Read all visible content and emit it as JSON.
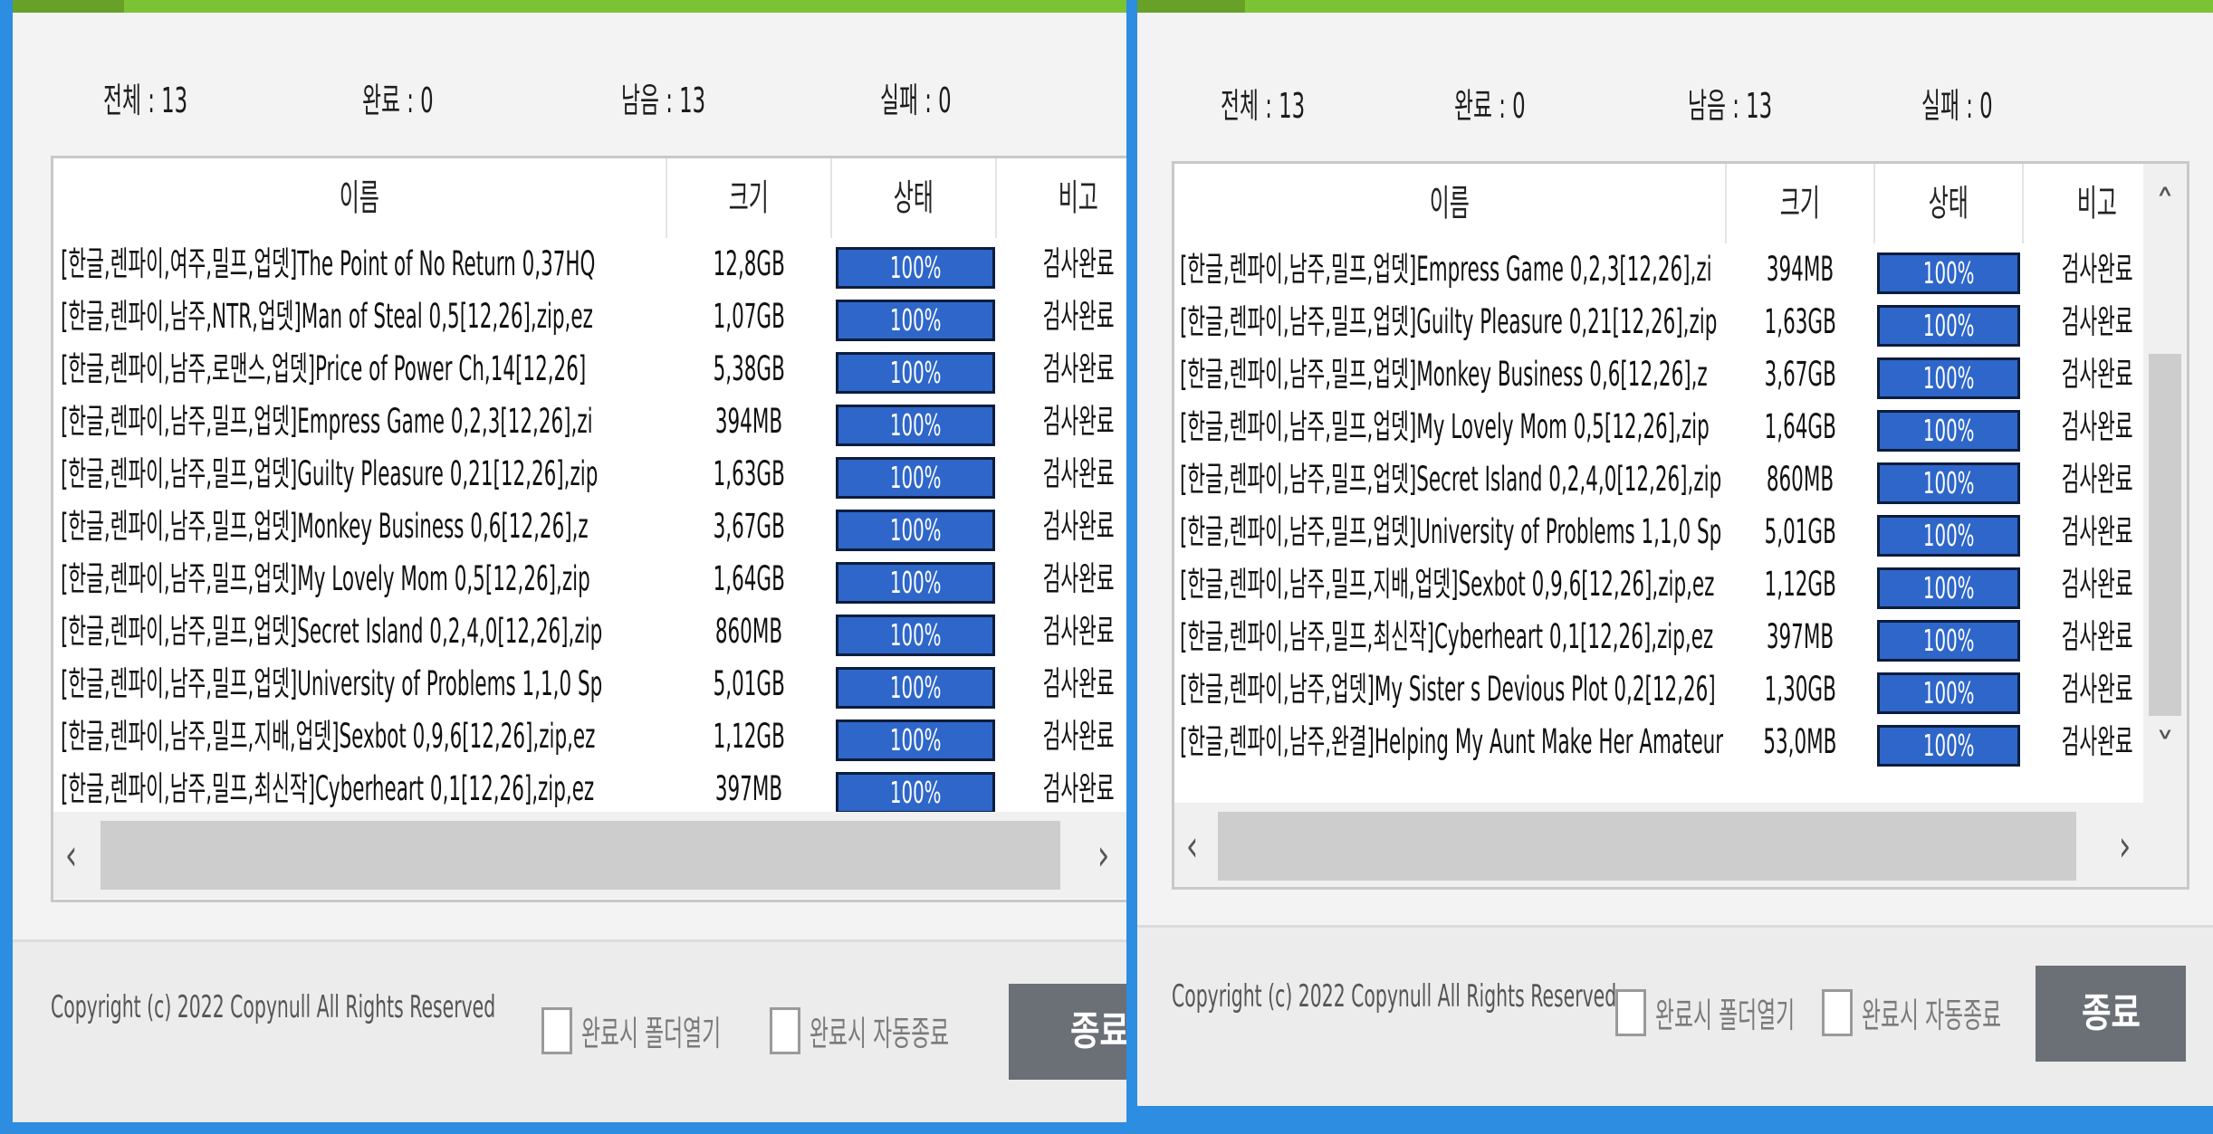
{
  "left": {
    "stats": {
      "total": "전체 : 13",
      "done": "완료 : 0",
      "remaining": "남음 : 13",
      "failed": "실패 : 0"
    },
    "columns": {
      "name": "이름",
      "size": "크기",
      "status": "상태",
      "note": "비고"
    },
    "rows": [
      {
        "name": "[한글,렌파이,여주,밀프,업뎃]The Point of No Return 0,37HQ",
        "size": "12,8GB",
        "progress": "100%",
        "progress_value": 100,
        "note": "검사완료"
      },
      {
        "name": "[한글,렌파이,남주,NTR,업뎃]Man of Steal 0,5[12,26],zip,ez",
        "size": "1,07GB",
        "progress": "100%",
        "progress_value": 100,
        "note": "검사완료"
      },
      {
        "name": "[한글,렌파이,남주,로맨스,업뎃]Price of Power Ch,14[12,26]",
        "size": "5,38GB",
        "progress": "100%",
        "progress_value": 100,
        "note": "검사완료"
      },
      {
        "name": "[한글,렌파이,남주,밀프,업뎃]Empress Game 0,2,3[12,26],zi",
        "size": "394MB",
        "progress": "100%",
        "progress_value": 100,
        "note": "검사완료"
      },
      {
        "name": "[한글,렌파이,남주,밀프,업뎃]Guilty Pleasure 0,21[12,26],zip",
        "size": "1,63GB",
        "progress": "100%",
        "progress_value": 100,
        "note": "검사완료"
      },
      {
        "name": "[한글,렌파이,남주,밀프,업뎃]Monkey Business 0,6[12,26],z",
        "size": "3,67GB",
        "progress": "100%",
        "progress_value": 100,
        "note": "검사완료"
      },
      {
        "name": "[한글,렌파이,남주,밀프,업뎃]My Lovely Mom 0,5[12,26],zip",
        "size": "1,64GB",
        "progress": "100%",
        "progress_value": 100,
        "note": "검사완료"
      },
      {
        "name": "[한글,렌파이,남주,밀프,업뎃]Secret Island 0,2,4,0[12,26],zip",
        "size": "860MB",
        "progress": "100%",
        "progress_value": 100,
        "note": "검사완료"
      },
      {
        "name": "[한글,렌파이,남주,밀프,업뎃]University of Problems 1,1,0 Sp",
        "size": "5,01GB",
        "progress": "100%",
        "progress_value": 100,
        "note": "검사완료"
      },
      {
        "name": "[한글,렌파이,남주,밀프,지배,업뎃]Sexbot 0,9,6[12,26],zip,ez",
        "size": "1,12GB",
        "progress": "100%",
        "progress_value": 100,
        "note": "검사완료"
      },
      {
        "name": "[한글,렌파이,남주,밀프,최신작]Cyberheart 0,1[12,26],zip,ez",
        "size": "397MB",
        "progress": "100%",
        "progress_value": 100,
        "note": "검사완료"
      }
    ],
    "scroll": {
      "left_arrow": "‹",
      "right_arrow": "›"
    },
    "footer": {
      "copyright": "Copyright (c) 2022 Copynull All Rights Reserved",
      "open_folder_label": "완료시 폴더열기",
      "auto_close_label": "완료시 자동종료",
      "close_label": "종료"
    }
  },
  "right": {
    "stats": {
      "total": "전체 : 13",
      "done": "완료 : 0",
      "remaining": "남음 : 13",
      "failed": "실패 : 0"
    },
    "columns": {
      "name": "이름",
      "size": "크기",
      "status": "상태",
      "note": "비고"
    },
    "rows": [
      {
        "name": "[한글,렌파이,남주,밀프,업뎃]Empress Game 0,2,3[12,26],zi",
        "size": "394MB",
        "progress": "100%",
        "progress_value": 100,
        "note": "검사완료"
      },
      {
        "name": "[한글,렌파이,남주,밀프,업뎃]Guilty Pleasure 0,21[12,26],zip",
        "size": "1,63GB",
        "progress": "100%",
        "progress_value": 100,
        "note": "검사완료"
      },
      {
        "name": "[한글,렌파이,남주,밀프,업뎃]Monkey Business 0,6[12,26],z",
        "size": "3,67GB",
        "progress": "100%",
        "progress_value": 100,
        "note": "검사완료"
      },
      {
        "name": "[한글,렌파이,남주,밀프,업뎃]My Lovely Mom 0,5[12,26],zip",
        "size": "1,64GB",
        "progress": "100%",
        "progress_value": 100,
        "note": "검사완료"
      },
      {
        "name": "[한글,렌파이,남주,밀프,업뎃]Secret Island 0,2,4,0[12,26],zip",
        "size": "860MB",
        "progress": "100%",
        "progress_value": 100,
        "note": "검사완료"
      },
      {
        "name": "[한글,렌파이,남주,밀프,업뎃]University of Problems 1,1,0 Sp",
        "size": "5,01GB",
        "progress": "100%",
        "progress_value": 100,
        "note": "검사완료"
      },
      {
        "name": "[한글,렌파이,남주,밀프,지배,업뎃]Sexbot 0,9,6[12,26],zip,ez",
        "size": "1,12GB",
        "progress": "100%",
        "progress_value": 100,
        "note": "검사완료"
      },
      {
        "name": "[한글,렌파이,남주,밀프,최신작]Cyberheart 0,1[12,26],zip,ez",
        "size": "397MB",
        "progress": "100%",
        "progress_value": 100,
        "note": "검사완료"
      },
      {
        "name": "[한글,렌파이,남주,업뎃]My Sister s Devious Plot 0,2[12,26]",
        "size": "1,30GB",
        "progress": "100%",
        "progress_value": 100,
        "note": "검사완료"
      },
      {
        "name": "[한글,렌파이,남주,완결]Helping My Aunt Make Her Amateur",
        "size": "53,0MB",
        "progress": "100%",
        "progress_value": 100,
        "note": "검사완료"
      }
    ],
    "scroll": {
      "left_arrow": "‹",
      "right_arrow": "›",
      "up_arrow": "˄",
      "down_arrow": "˅"
    },
    "footer": {
      "copyright": "Copyright (c) 2022 Copynull All Rights Reserved",
      "open_folder_label": "완료시 폴더열기",
      "auto_close_label": "완료시 자동종료",
      "close_label": "종료"
    }
  },
  "colors": {
    "accent_green": "#7cc334",
    "progress_blue": "#2e66c9",
    "background_blue": "#2d8de0",
    "close_button": "#6b6f76"
  }
}
